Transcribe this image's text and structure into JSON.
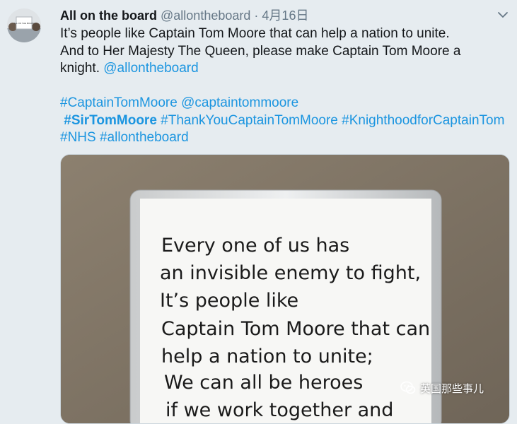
{
  "tweet": {
    "author_name": "All on the board",
    "author_handle": "@allontheboard",
    "separator": "·",
    "date": "4月16日",
    "text_line1": "It’s people like Captain Tom Moore that can help a nation to unite.",
    "text_line2": "And to Her Majesty The Queen, please make Captain Tom Moore a",
    "text_line3_plain": "knight. ",
    "mention1": "@allontheboard",
    "hashtag_captaintommoore": "#CaptainTomMoore",
    "mention2": "@captaintommoore",
    "hashtag_sirtommoore": "#SirTomMoore",
    "hashtag_thankyou": "#ThankYouCaptainTomMoore",
    "hashtag_knighthood": "#KnighthoodforCaptainTom",
    "hashtag_nhs": "#NHS",
    "hashtag_allontheboard": "#allontheboard"
  },
  "avatar": {
    "sign_text": "ALL ON THE BOARD"
  },
  "media": {
    "board_lines": [
      "Every one of us has",
      "an invisible enemy to fight,",
      "It’s people like",
      "Captain Tom Moore that can",
      "help a nation to unite;",
      "We can all be heroes",
      "if we work together and"
    ]
  },
  "watermark": {
    "text": "英国那些事儿"
  },
  "icons": {
    "more": "chevron-down-icon",
    "watermark": "wechat-icon"
  },
  "colors": {
    "link": "#1b95e0",
    "background": "#e6ecf0",
    "text": "#14171a",
    "secondary": "#657786"
  }
}
